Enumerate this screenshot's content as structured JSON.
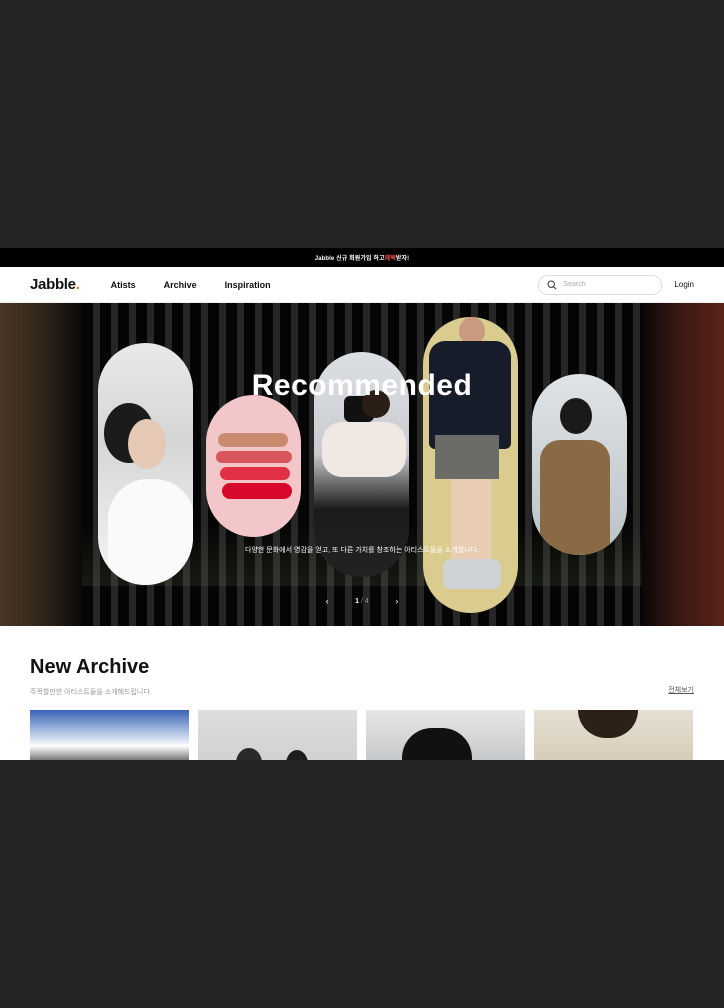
{
  "promo": {
    "prefix": "Jabble 신규 회원가입 하고 ",
    "highlight": "혜택",
    "suffix": " 받자!"
  },
  "nav": {
    "logo": "Jabble",
    "logo_dot": ".",
    "menu": [
      "Atists",
      "Archive",
      "Inspiration"
    ],
    "search_placeholder": "Search",
    "login": "Login"
  },
  "hero": {
    "title": "Recommended",
    "subtitle": "다양한 문화에서 영감을 얻고, 또 다른 가치를 창조하는 아티스트들을 소개합니다.",
    "page_current": "1",
    "page_sep": " / ",
    "page_total": "4",
    "prev_icon": "chevron-left-icon",
    "next_icon": "chevron-right-icon"
  },
  "archive": {
    "title": "New Archive",
    "description": "주목할만한 아티스트들을 소개해드립니다.",
    "view_all": "전체보기"
  },
  "colors": {
    "accent": "#e07b1f",
    "promo_highlight": "#e8514a"
  }
}
